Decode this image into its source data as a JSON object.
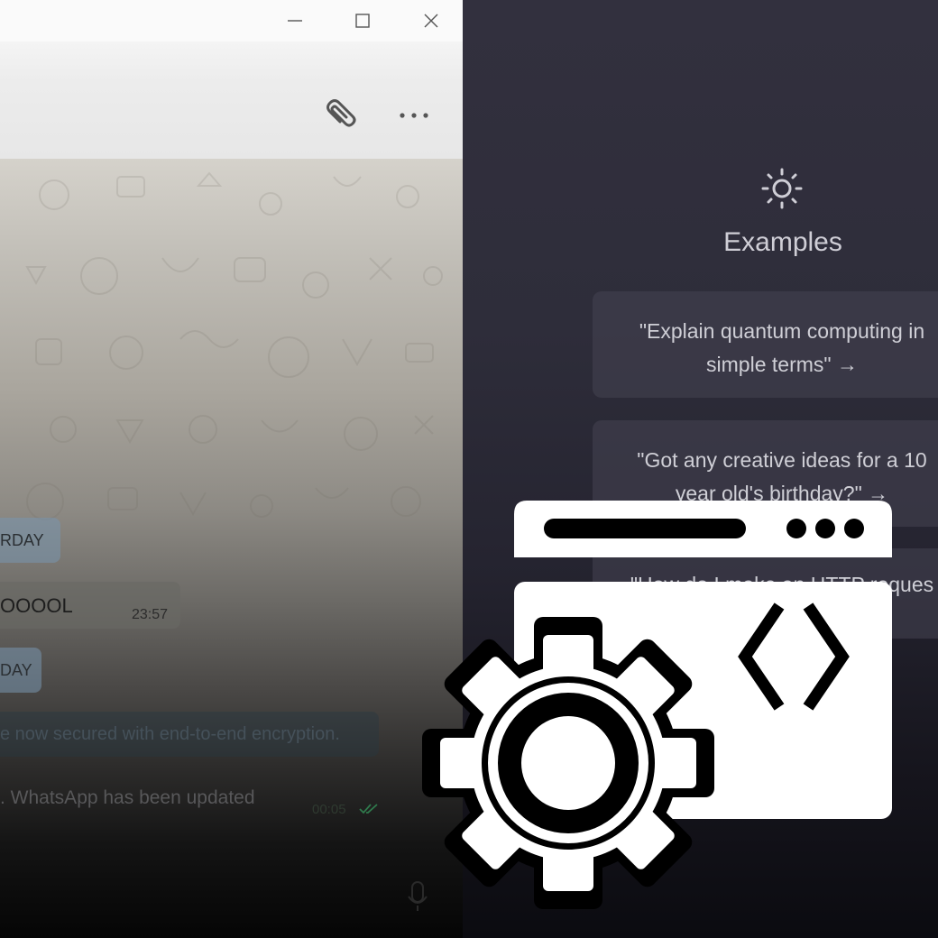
{
  "chat_window": {
    "window_controls": {
      "minimize_icon": "minimize-icon",
      "maximize_icon": "maximize-icon",
      "close_icon": "close-icon"
    },
    "header": {
      "attach_icon": "paperclip-icon",
      "menu_icon": "more-options-icon"
    },
    "messages": {
      "date_pill_1": "RDAY",
      "incoming_text": "OOOOL",
      "incoming_time": "23:57",
      "date_pill_2": "DAY",
      "system_notice": "e now secured with end-to-end encryption.",
      "outgoing_text": ". WhatsApp has been updated",
      "outgoing_time": "00:05",
      "read_icon": "double-check-icon"
    },
    "composer": {
      "mic_icon": "microphone-icon"
    }
  },
  "assistant_panel": {
    "examples_icon": "sun-icon",
    "examples_title": "Examples",
    "examples": [
      {
        "line1": "\"Explain quantum computing in",
        "line2": "simple terms\" →"
      },
      {
        "line1": "\"Got any creative ideas for a 10",
        "line2": "year old's birthday?\" →"
      },
      {
        "line1": "\"How do I make an HTTP reques",
        "line2": ""
      }
    ]
  },
  "overlay_graphic": {
    "icon": "browser-code-settings-icon",
    "color": "#ffffff"
  },
  "colors": {
    "titlebar": "#fafafa",
    "header": "#ececec",
    "dark_panel": "#2e2d3a",
    "read_tick": "#3aa86b"
  }
}
